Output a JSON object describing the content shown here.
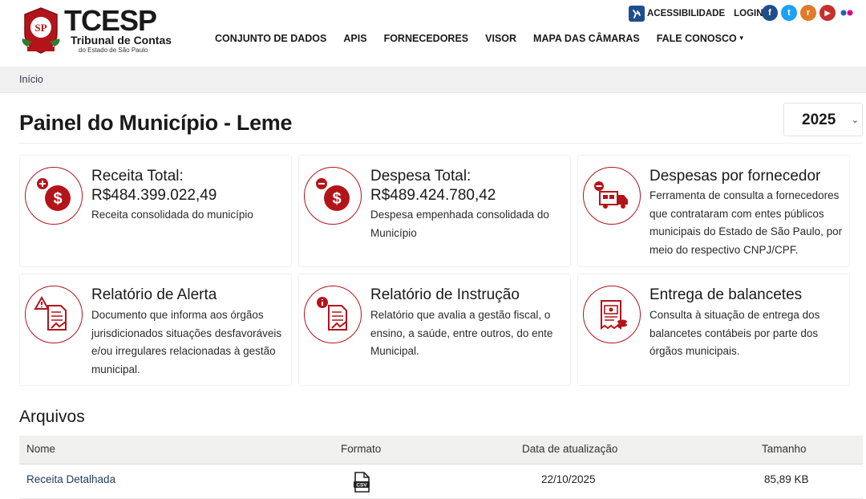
{
  "header": {
    "logo_title": "TCESP",
    "logo_sub1": "Tribunal de Contas",
    "logo_sub2": "do Estado de São Paulo",
    "logo_seal_text": "SP",
    "nav": [
      {
        "label": "CONJUNTO DE DADOS"
      },
      {
        "label": "APIS"
      },
      {
        "label": "FORNECEDORES"
      },
      {
        "label": "VISOR"
      },
      {
        "label": "MAPA DAS CÂMARAS"
      },
      {
        "label": "FALE CONOSCO"
      }
    ],
    "accessibility": "ACESSIBILIDADE",
    "login": "LOGIN",
    "social": [
      {
        "icon": "facebook-icon",
        "glyph": "f",
        "color": "#1f4e8c"
      },
      {
        "icon": "twitter-icon",
        "glyph": "t",
        "color": "#1da1f2"
      },
      {
        "icon": "rss-icon",
        "glyph": "r",
        "color": "#e07a2c"
      },
      {
        "icon": "youtube-icon",
        "glyph": "▶",
        "color": "#c4302b"
      },
      {
        "icon": "flickr-icon",
        "glyph": "",
        "color": "#ffffff"
      }
    ]
  },
  "breadcrumb": {
    "home": "Início"
  },
  "page": {
    "title": "Painel do Município - Leme",
    "year": "2025"
  },
  "cards": [
    {
      "title": "Receita Total:",
      "amount": "R$484.399.022,49",
      "desc": "Receita consolidada do município",
      "icon": "revenue-icon"
    },
    {
      "title": "Despesa Total:",
      "amount": "R$489.424.780,42",
      "desc": "Despesa empenhada consolidada do Município",
      "icon": "expense-icon"
    },
    {
      "title": "Despesas por fornecedor",
      "amount": "",
      "desc": "Ferramenta de consulta a fornecedores que contrataram com entes públicos municipais do Estado de São Paulo, por meio do respectivo CNPJ/CPF.",
      "icon": "supplier-truck-icon"
    },
    {
      "title": "Relatório de Alerta",
      "amount": "",
      "desc": "Documento que informa aos órgãos jurisdicionados situações desfavoráveis e/ou irregulares relacionadas à gestão municipal.",
      "icon": "alert-report-icon"
    },
    {
      "title": "Relatório de Instrução",
      "amount": "",
      "desc": "Relatório que avalia a gestão fiscal, o ensino, a saúde, entre outros, do ente Municipal.",
      "icon": "instruction-report-icon"
    },
    {
      "title": "Entrega de balancetes",
      "amount": "",
      "desc": "Consulta à situação de entrega dos balancetes contábeis por parte dos órgãos municipais.",
      "icon": "balance-sheet-icon"
    }
  ],
  "files": {
    "title": "Arquivos",
    "columns": [
      "Nome",
      "Formato",
      "Data de atualização",
      "Tamanho"
    ],
    "rows": [
      {
        "name": "Receita Detalhada",
        "format": "csv-file-icon",
        "date": "22/10/2025",
        "size": "85,89 KB"
      }
    ]
  },
  "colors": {
    "accent": "#b3141a",
    "nav_dark": "#1a1a1a",
    "link": "#1f3a5f"
  }
}
